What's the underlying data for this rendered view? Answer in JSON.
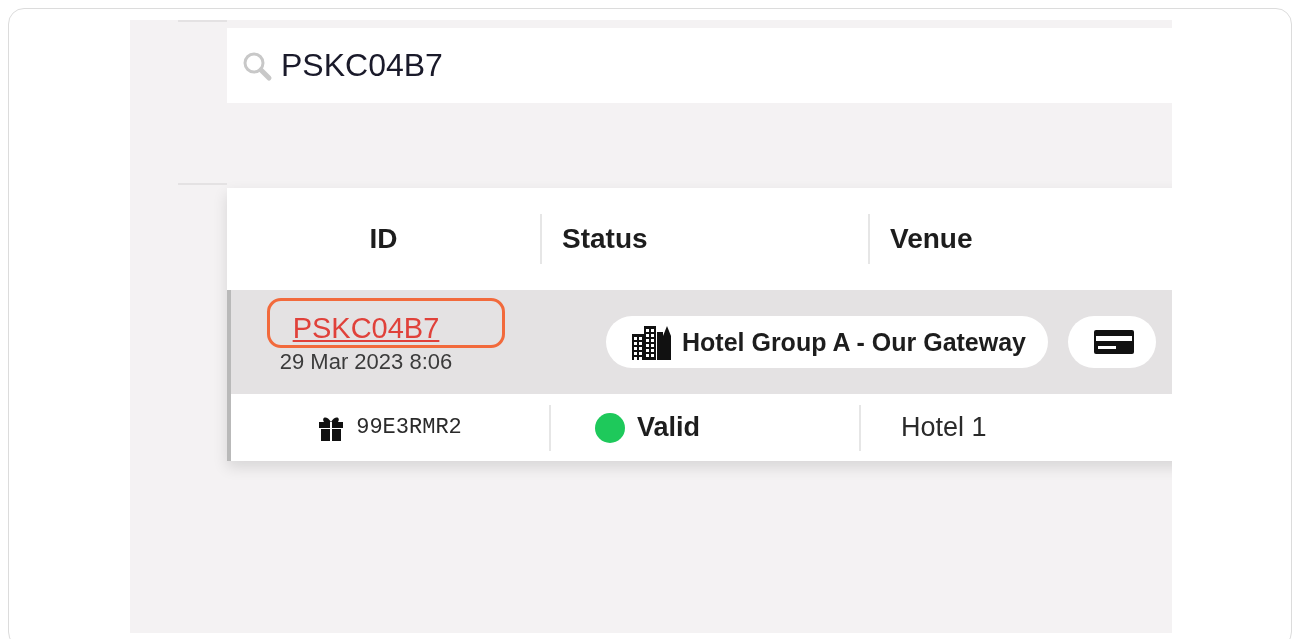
{
  "search": {
    "value": "PSKC04B7"
  },
  "table": {
    "columns": [
      "ID",
      "Status",
      "Venue"
    ],
    "group": {
      "id": "PSKC04B7",
      "date": "29 Mar 2023 8:06",
      "highlighted": true,
      "chips": [
        {
          "kind": "venue",
          "label": "Hotel Group A - Our Gateway"
        },
        {
          "kind": "card"
        }
      ]
    },
    "rows": [
      {
        "code": "99E3RMR2",
        "status": "Valid",
        "color": "#1ec95b",
        "venue": "Hotel 1"
      }
    ]
  }
}
